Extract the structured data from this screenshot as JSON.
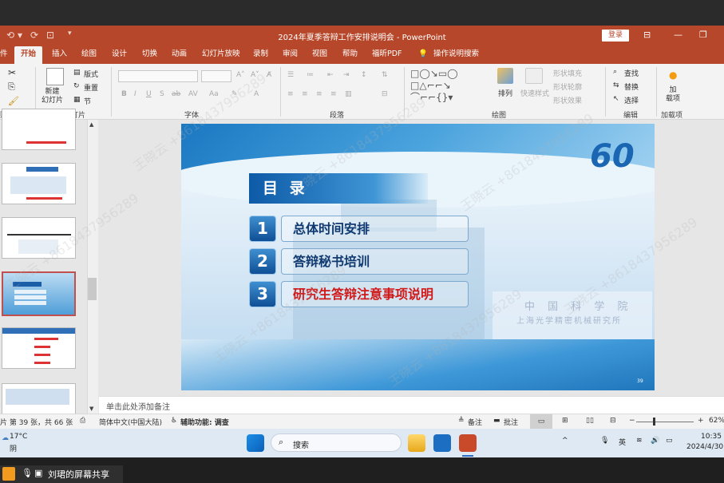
{
  "app": {
    "title": "2024年夏季答辩工作安排说明会 - PowerPoint",
    "login": "登录"
  },
  "menu": {
    "tabs": [
      "件",
      "开始",
      "插入",
      "绘图",
      "设计",
      "切换",
      "动画",
      "幻灯片放映",
      "录制",
      "审阅",
      "视图",
      "帮助",
      "福昕PDF",
      "操作说明搜索"
    ],
    "active": "开始"
  },
  "ribbon": {
    "clipboard_label": "贴板",
    "new_slide": "新建\n幻灯片",
    "layout": "版式",
    "reset": "重置",
    "section": "节",
    "slides_label": "幻灯片",
    "font_label": "字体",
    "paragraph_label": "段落",
    "arrange": "排列",
    "quick_styles": "快速样式",
    "shape_fill": "形状填充",
    "shape_outline": "形状轮廓",
    "shape_effects": "形状效果",
    "drawing_label": "绘图",
    "find": "查找",
    "replace": "替换",
    "select": "选择",
    "editing_label": "编辑",
    "addin": "加\n载项",
    "addins_label": "加载项"
  },
  "slide": {
    "heading": "目 录",
    "items": [
      {
        "num": "1",
        "text": "总体时间安排"
      },
      {
        "num": "2",
        "text": "答辩秘书培训"
      },
      {
        "num": "3",
        "text": "研究生答辩注意事项说明"
      }
    ],
    "logo": "60",
    "page_no": "39",
    "sign_line1": "中 国 科 学 院",
    "sign_line2": "上海光学精密机械研究所"
  },
  "notes": {
    "placeholder": "单击此处添加备注"
  },
  "status": {
    "slide_info": "片 第 39 张，共 66 张",
    "language": "简体中文(中国大陆)",
    "accessibility": "辅助功能: 调查",
    "notes_btn": "备注",
    "comments_btn": "批注",
    "zoom": "62%"
  },
  "taskbar": {
    "weather_temp": "17°C",
    "weather_desc": "阴",
    "search": "搜索",
    "ime": "英",
    "time": "10:35",
    "date": "2024/4/30"
  },
  "share": {
    "label": "刘珺的屏幕共享"
  },
  "watermark": "王晓云 +8618437956289"
}
